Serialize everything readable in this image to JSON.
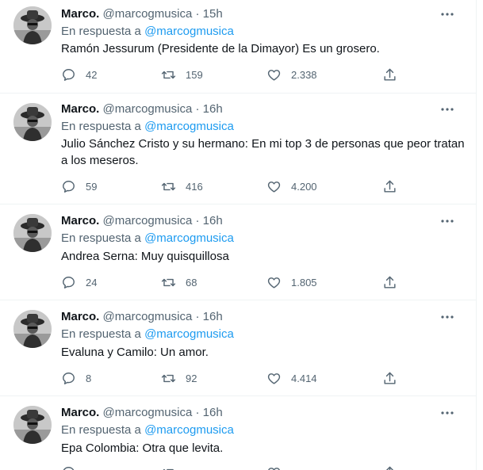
{
  "tweets": [
    {
      "name": "Marco.",
      "handle": "@marcogmusica",
      "sep": "·",
      "time": "15h",
      "reply_prefix": "En respuesta a",
      "reply_to": "@marcogmusica",
      "text": "Ramón Jessurum (Presidente de la Dimayor) Es un grosero.",
      "replies": "42",
      "retweets": "159",
      "likes": "2.338"
    },
    {
      "name": "Marco.",
      "handle": "@marcogmusica",
      "sep": "·",
      "time": "16h",
      "reply_prefix": "En respuesta a",
      "reply_to": "@marcogmusica",
      "text": "Julio Sánchez Cristo y su hermano: En mi top 3 de personas que peor tratan a los meseros.",
      "replies": "59",
      "retweets": "416",
      "likes": "4.200"
    },
    {
      "name": "Marco.",
      "handle": "@marcogmusica",
      "sep": "·",
      "time": "16h",
      "reply_prefix": "En respuesta a",
      "reply_to": "@marcogmusica",
      "text": "Andrea Serna: Muy quisquillosa",
      "replies": "24",
      "retweets": "68",
      "likes": "1.805"
    },
    {
      "name": "Marco.",
      "handle": "@marcogmusica",
      "sep": "·",
      "time": "16h",
      "reply_prefix": "En respuesta a",
      "reply_to": "@marcogmusica",
      "text": "Evaluna y Camilo: Un amor.",
      "replies": "8",
      "retweets": "92",
      "likes": "4.414"
    },
    {
      "name": "Marco.",
      "handle": "@marcogmusica",
      "sep": "·",
      "time": "16h",
      "reply_prefix": "En respuesta a",
      "reply_to": "@marcogmusica",
      "text": "Epa Colombia: Otra que levita."
    }
  ],
  "colors": {
    "text": "#0f1419",
    "secondary": "#536471",
    "link": "#1d9bf0",
    "divider": "#eff3f4"
  },
  "icons": [
    "more-icon",
    "reply-icon",
    "retweet-icon",
    "like-icon",
    "share-icon"
  ]
}
